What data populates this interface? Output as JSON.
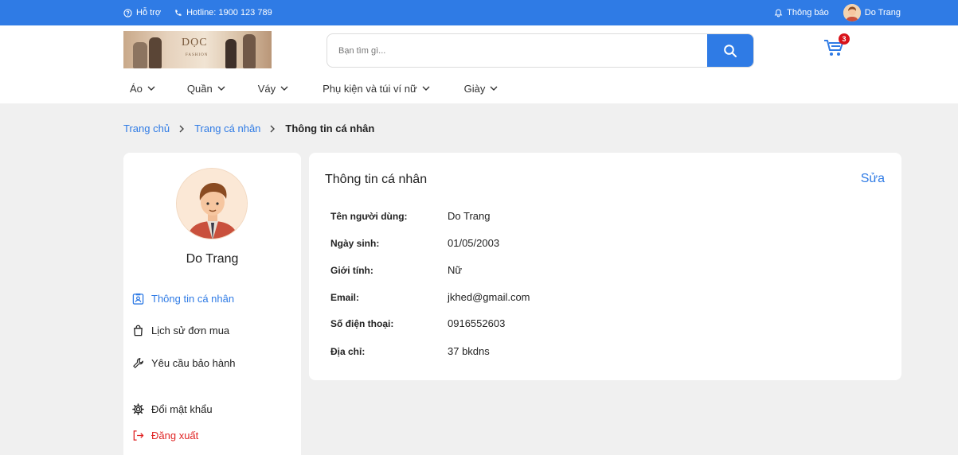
{
  "topbar": {
    "support_label": "Hỗ trợ",
    "hotline_label": "Hotline: 1900 123 789",
    "notifications_label": "Thông báo",
    "user_name": "Do Trang"
  },
  "header": {
    "logo_text": "DỌC",
    "logo_subtext": "FASHION",
    "search_placeholder": "Bạn tìm gì...",
    "cart_count": "3"
  },
  "nav": {
    "items": [
      {
        "label": "Áo"
      },
      {
        "label": "Quần"
      },
      {
        "label": "Váy"
      },
      {
        "label": "Phụ kiện và túi ví nữ"
      },
      {
        "label": "Giày"
      }
    ]
  },
  "breadcrumb": {
    "home": "Trang chủ",
    "profile": "Trang cá nhân",
    "current": "Thông tin cá nhân"
  },
  "sidebar": {
    "name": "Do Trang",
    "menu": [
      {
        "label": "Thông tin cá nhân",
        "icon": "id-card-icon"
      },
      {
        "label": "Lịch sử đơn mua",
        "icon": "shopping-bag-icon"
      },
      {
        "label": "Yêu cầu bảo hành",
        "icon": "wrench-icon"
      },
      {
        "label": "Đổi mật khẩu",
        "icon": "gear-icon"
      },
      {
        "label": "Đăng xuất",
        "icon": "logout-icon"
      }
    ]
  },
  "info": {
    "title": "Thông tin cá nhân",
    "edit_label": "Sửa",
    "fields": [
      {
        "label": "Tên người dùng:",
        "value": "Do Trang"
      },
      {
        "label": "Ngày sinh:",
        "value": "01/05/2003"
      },
      {
        "label": "Giới tính:",
        "value": "Nữ"
      },
      {
        "label": "Email:",
        "value": "jkhed@gmail.com"
      },
      {
        "label": "Số điện thoại:",
        "value": "0916552603"
      },
      {
        "label": "Địa chỉ:",
        "value": "37 bkdns"
      }
    ]
  },
  "colors": {
    "primary": "#2f7be5",
    "danger": "#e02424",
    "badge": "#d9131a",
    "background": "#f0f0f0"
  }
}
